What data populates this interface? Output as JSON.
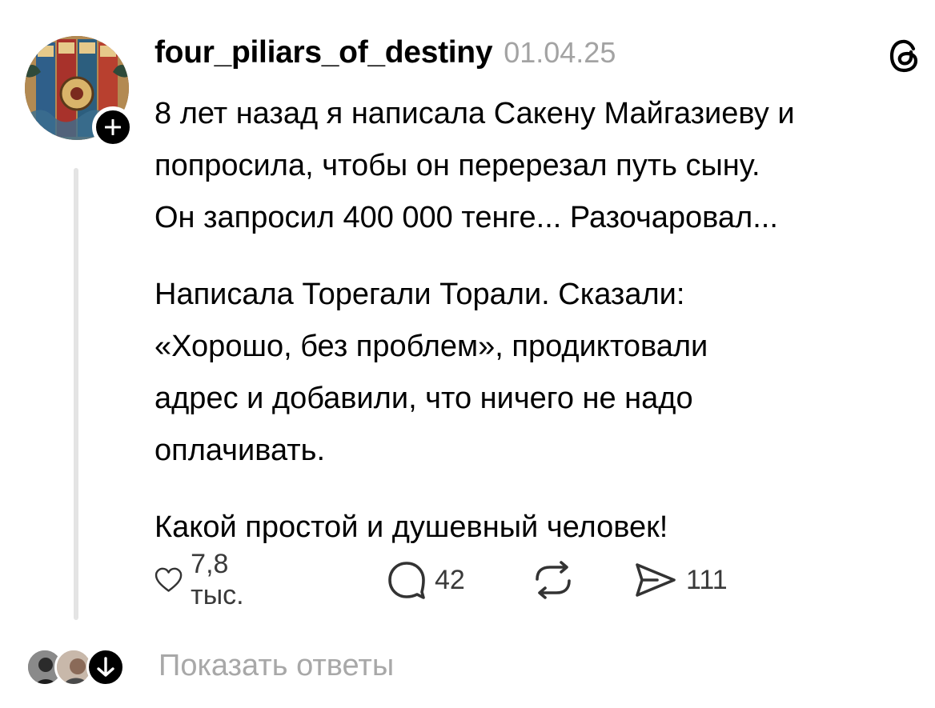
{
  "post": {
    "username": "four_piliars_of_destiny",
    "date": "01.04.25",
    "avatar_icon": "bazi-four-pillars-avatar",
    "follow_icon": "plus-icon",
    "app_icon": "threads-logo-icon",
    "paragraphs": [
      [
        "8 лет назад я написала Сакену Майгазиеву и",
        "попросила, чтобы он перерезал путь сыну.",
        "Он запросил 400 000 тенге... Разочаровал..."
      ],
      [
        "Написала Торегали Торали. Сказали:",
        "«Хорошо, без проблем», продиктовали",
        "адрес и добавили, что ничего не надо",
        "оплачивать."
      ],
      [
        "Какой простой и душевный человек!"
      ]
    ]
  },
  "actions": {
    "like": {
      "icon": "heart-icon",
      "count": "7,8 тыс."
    },
    "comment": {
      "icon": "comment-bubble-icon",
      "count": "42"
    },
    "repost": {
      "icon": "repost-icon"
    },
    "share": {
      "icon": "send-icon",
      "count": "111"
    }
  },
  "replies": {
    "label": "Показать ответы",
    "icon": "arrow-down-circle-icon"
  }
}
